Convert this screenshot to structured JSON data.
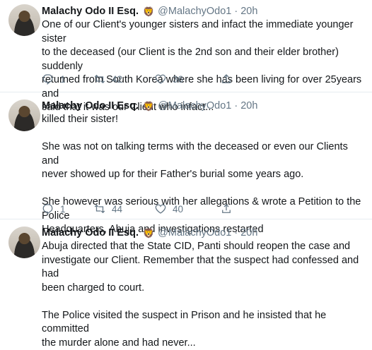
{
  "tweets": [
    {
      "name": "Malachy Odo II Esq.",
      "badge": "🦁",
      "handle": "@MalachyOdo1",
      "dot": "·",
      "time": "20h",
      "text": "One of our Client's younger sisters and infact the immediate younger sister\nto the deceased (our Client is the 2nd son and their elder brother) suddenly\nreturned from South Korea where she has been living for over 25years and\nsaid that it was our Client who infact...",
      "replies": "1",
      "retweets": "42",
      "likes": "36",
      "icons": [
        "reply-icon",
        "retweet-icon",
        "like-icon",
        "share-icon"
      ]
    },
    {
      "name": "Malachy Odo II Esq.",
      "badge": "🦁",
      "handle": "@MalachyOdo1",
      "dot": "·",
      "time": "20h",
      "text": "killed their sister!\n\nShe was not on talking terms with the deceased or even our Clients and\nnever showed up for their Father's burial some years ago.\n\nShe however was serious with her allegations & wrote a Petition to the Police\nHeadquarters, Abuja and investigations restarted",
      "replies": "1",
      "retweets": "44",
      "likes": "40",
      "icons": [
        "reply-icon",
        "retweet-icon",
        "like-icon",
        "share-icon"
      ]
    },
    {
      "name": "Malachy Odo II Esq.",
      "badge": "🦁",
      "handle": "@MalachyOdo1",
      "dot": "·",
      "time": "20h",
      "text": "Abuja directed that the State CID, Panti should reopen the case and\ninvestigate our Client. Remember that the suspect had confessed and had\nbeen charged to court.\n\nThe Police visited the suspect in Prison and he insisted that he committed\nthe murder alone and had never...",
      "icons": []
    }
  ],
  "colors": {
    "text": "#14171a",
    "muted": "#657786",
    "divider": "#e6ecf0"
  }
}
